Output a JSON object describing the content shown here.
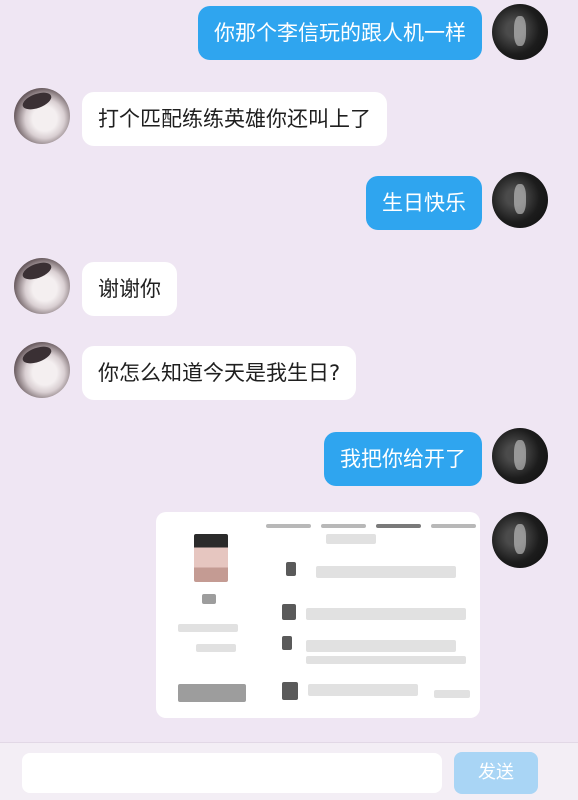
{
  "messages": [
    {
      "side": "me",
      "text": "你那个李信玩的跟人机一样"
    },
    {
      "side": "them",
      "text": "打个匹配练练英雄你还叫上了"
    },
    {
      "side": "me",
      "text": "生日快乐"
    },
    {
      "side": "them",
      "text": "谢谢你"
    },
    {
      "side": "them",
      "text": "你怎么知道今天是我生日?"
    },
    {
      "side": "me",
      "text": "我把你给开了"
    }
  ],
  "attachment": {
    "type": "blurred-screenshot"
  },
  "composer": {
    "placeholder": "",
    "send_label": "发送"
  },
  "colors": {
    "my_bubble": "#2fa5ef",
    "their_bubble": "#ffffff",
    "background": "#efe6f3"
  }
}
